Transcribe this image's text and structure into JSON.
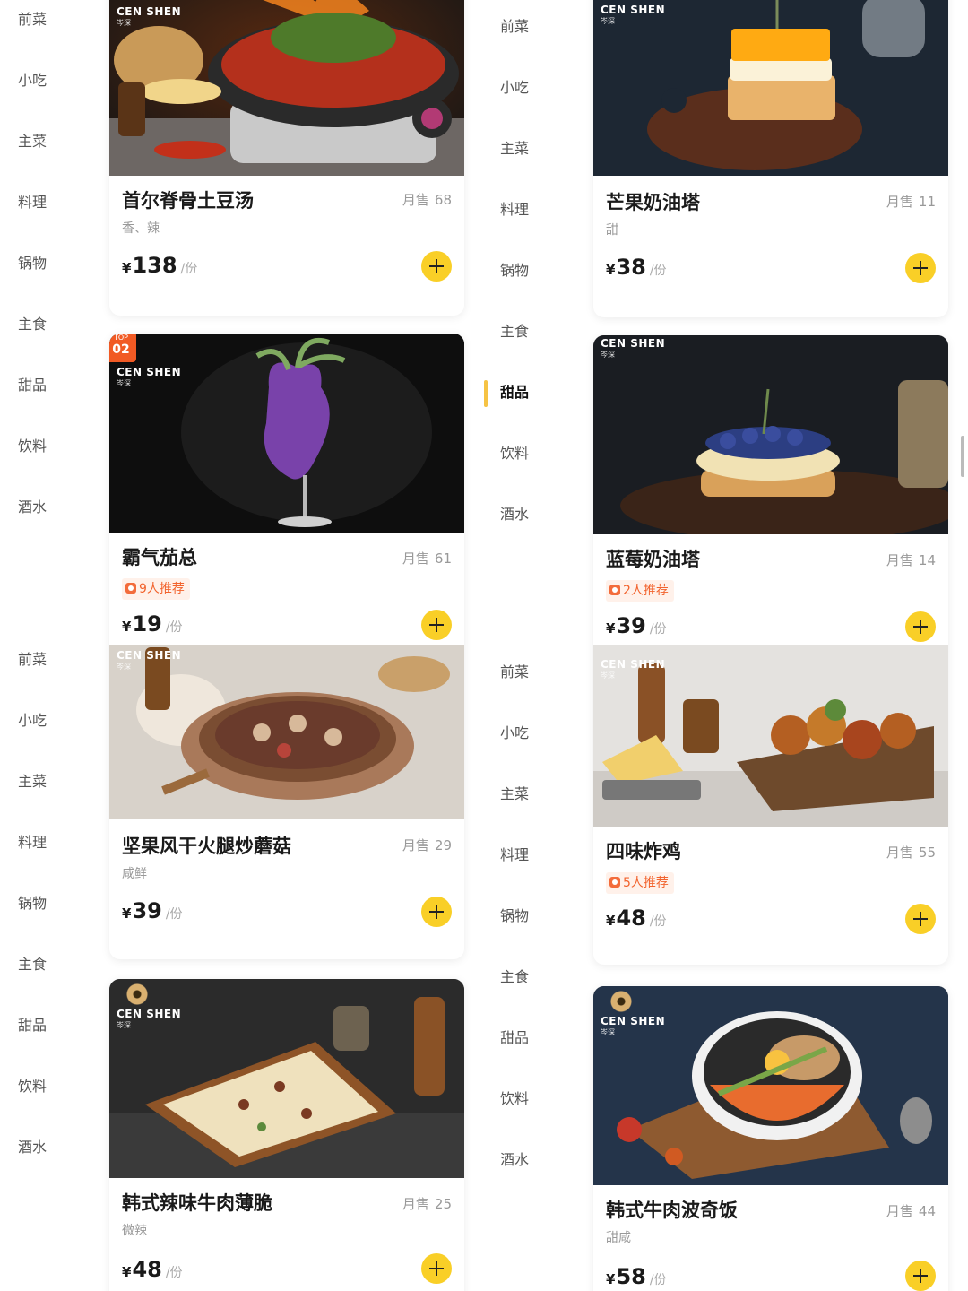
{
  "categories": [
    "前菜",
    "小吃",
    "主菜",
    "料理",
    "锅物",
    "主食",
    "甜品",
    "饮料",
    "酒水"
  ],
  "active_category": "甜品",
  "price_unit": "/份",
  "currency": "¥",
  "sold_label": "月售",
  "brand": {
    "en": "CEN SHEN",
    "cn": "岑深"
  },
  "accent": "#f9cf27",
  "recommend_color": "#f2632d",
  "dishes": [
    {
      "name": "首尔脊骨土豆汤",
      "sold": "68",
      "desc": "香、辣",
      "price": "138"
    },
    {
      "name": "霸气茄总",
      "sold": "61",
      "recommend": "9人推荐",
      "price": "19",
      "rank_label": "TOP",
      "rank": "02"
    },
    {
      "name": "芒果奶油塔",
      "sold": "11",
      "desc": "甜",
      "price": "38"
    },
    {
      "name": "蓝莓奶油塔",
      "sold": "14",
      "recommend": "2人推荐",
      "price": "39"
    },
    {
      "name": "坚果风干火腿炒蘑菇",
      "sold": "29",
      "desc": "咸鲜",
      "price": "39"
    },
    {
      "name": "韩式辣味牛肉薄脆",
      "sold": "25",
      "desc": "微辣",
      "price": "48"
    },
    {
      "name": "四味炸鸡",
      "sold": "55",
      "recommend": "5人推荐",
      "price": "48"
    },
    {
      "name": "韩式牛肉波奇饭",
      "sold": "44",
      "desc": "甜咸",
      "price": "58"
    }
  ]
}
